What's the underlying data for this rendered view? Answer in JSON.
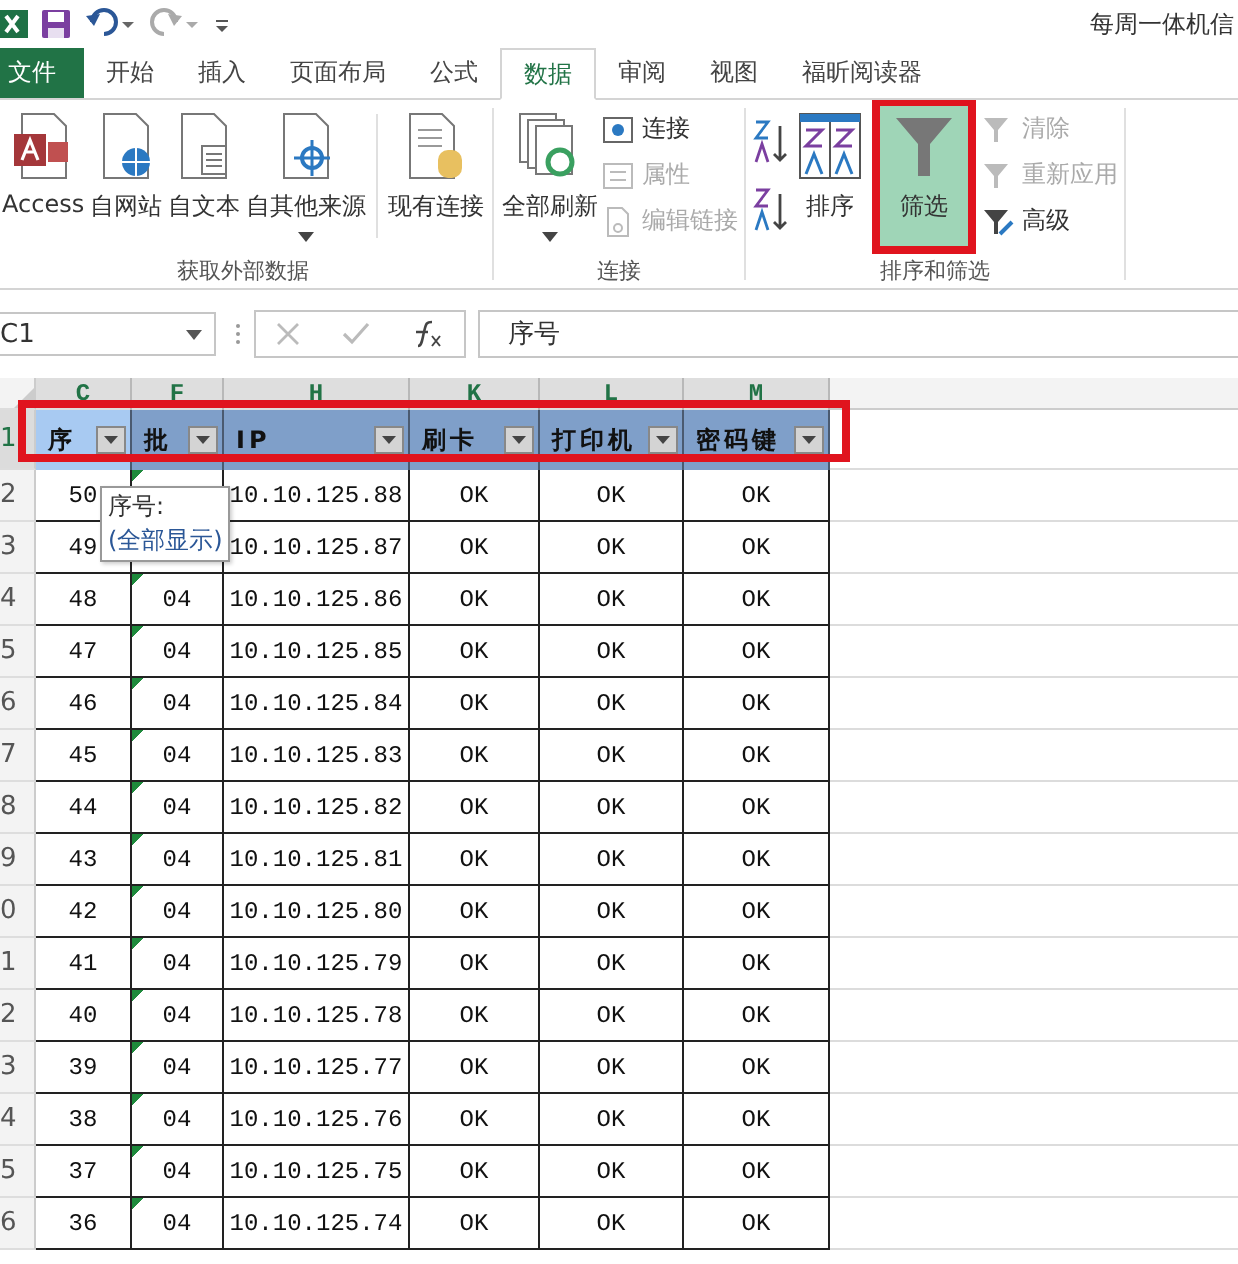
{
  "title_bar": {
    "title": "每周一体机信"
  },
  "tabs": [
    {
      "label": "文件",
      "kind": "file",
      "selected": false
    },
    {
      "label": "开始",
      "kind": "tab",
      "selected": false
    },
    {
      "label": "插入",
      "kind": "tab",
      "selected": false
    },
    {
      "label": "页面布局",
      "kind": "tab",
      "selected": false
    },
    {
      "label": "公式",
      "kind": "tab",
      "selected": false
    },
    {
      "label": "数据",
      "kind": "tab",
      "selected": true
    },
    {
      "label": "审阅",
      "kind": "tab",
      "selected": false
    },
    {
      "label": "视图",
      "kind": "tab",
      "selected": false
    },
    {
      "label": "福昕阅读器",
      "kind": "tab",
      "selected": false
    }
  ],
  "ribbon": {
    "groups": [
      {
        "label": "获取外部数据",
        "items": [
          {
            "kind": "large",
            "label": "Access",
            "caret": false
          },
          {
            "kind": "large",
            "label": "自网站",
            "caret": false
          },
          {
            "kind": "large",
            "label": "自文本",
            "caret": false
          },
          {
            "kind": "large",
            "label": "自其他来源",
            "caret": true
          },
          {
            "kind": "sep"
          },
          {
            "kind": "large",
            "label": "现有连接",
            "caret": false
          }
        ]
      },
      {
        "label": "连接",
        "items": [
          {
            "kind": "large",
            "label": "全部刷新",
            "caret": true
          },
          {
            "kind": "small-stack",
            "entries": [
              {
                "label": "连接",
                "disabled": false
              },
              {
                "label": "属性",
                "disabled": true
              },
              {
                "label": "编辑链接",
                "disabled": true
              }
            ]
          }
        ]
      },
      {
        "label": "排序和筛选",
        "items": [
          {
            "kind": "sort-az"
          },
          {
            "kind": "large",
            "label": "排序",
            "caret": false
          },
          {
            "kind": "large",
            "label": "筛选",
            "caret": false,
            "active": true
          },
          {
            "kind": "small-stack",
            "entries": [
              {
                "label": "清除",
                "disabled": true
              },
              {
                "label": "重新应用",
                "disabled": true
              },
              {
                "label": "高级",
                "disabled": false
              }
            ]
          }
        ]
      }
    ]
  },
  "formula_bar": {
    "name_box": "C1",
    "formula": "序号"
  },
  "sheet": {
    "column_letters": [
      "C",
      "F",
      "H",
      "K",
      "L",
      "M"
    ],
    "headers": [
      {
        "label": "序",
        "selected": true
      },
      {
        "label": "批",
        "selected": false
      },
      {
        "label": "IP",
        "selected": false
      },
      {
        "label": "刷卡",
        "selected": false
      },
      {
        "label": "打印机",
        "selected": false
      },
      {
        "label": "密码键",
        "selected": false
      }
    ],
    "header_row_number": "1",
    "rows": [
      {
        "row": "2",
        "cells": [
          "50",
          null,
          "10.10.125.88",
          "OK",
          "OK",
          "OK"
        ]
      },
      {
        "row": "3",
        "cells": [
          "49",
          null,
          "10.10.125.87",
          "OK",
          "OK",
          "OK"
        ]
      },
      {
        "row": "4",
        "cells": [
          "48",
          "04",
          "10.10.125.86",
          "OK",
          "OK",
          "OK"
        ]
      },
      {
        "row": "5",
        "cells": [
          "47",
          "04",
          "10.10.125.85",
          "OK",
          "OK",
          "OK"
        ]
      },
      {
        "row": "6",
        "cells": [
          "46",
          "04",
          "10.10.125.84",
          "OK",
          "OK",
          "OK"
        ]
      },
      {
        "row": "7",
        "cells": [
          "45",
          "04",
          "10.10.125.83",
          "OK",
          "OK",
          "OK"
        ]
      },
      {
        "row": "8",
        "cells": [
          "44",
          "04",
          "10.10.125.82",
          "OK",
          "OK",
          "OK"
        ]
      },
      {
        "row": "9",
        "cells": [
          "43",
          "04",
          "10.10.125.81",
          "OK",
          "OK",
          "OK"
        ]
      },
      {
        "row": "0",
        "cells": [
          "42",
          "04",
          "10.10.125.80",
          "OK",
          "OK",
          "OK"
        ]
      },
      {
        "row": "1",
        "cells": [
          "41",
          "04",
          "10.10.125.79",
          "OK",
          "OK",
          "OK"
        ]
      },
      {
        "row": "2",
        "cells": [
          "40",
          "04",
          "10.10.125.78",
          "OK",
          "OK",
          "OK"
        ]
      },
      {
        "row": "3",
        "cells": [
          "39",
          "04",
          "10.10.125.77",
          "OK",
          "OK",
          "OK"
        ]
      },
      {
        "row": "4",
        "cells": [
          "38",
          "04",
          "10.10.125.76",
          "OK",
          "OK",
          "OK"
        ]
      },
      {
        "row": "5",
        "cells": [
          "37",
          "04",
          "10.10.125.75",
          "OK",
          "OK",
          "OK"
        ]
      },
      {
        "row": "6",
        "cells": [
          "36",
          "04",
          "10.10.125.74",
          "OK",
          "OK",
          "OK"
        ]
      }
    ],
    "tooltip": {
      "title": "序号:",
      "value": "(全部显示)"
    }
  }
}
